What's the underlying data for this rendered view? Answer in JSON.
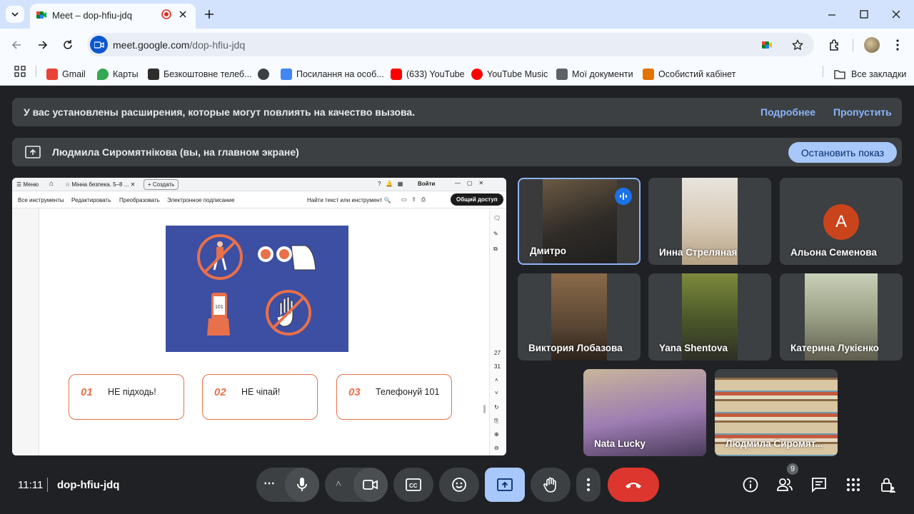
{
  "browser": {
    "tab_title": "Meet – dop-hfiu-jdq",
    "url_host": "meet.google.com",
    "url_path": "/dop-hfiu-jdq",
    "bookmarks": [
      {
        "label": "Gmail",
        "color": "#ea4335"
      },
      {
        "label": "Карты",
        "color": "#34a853"
      },
      {
        "label": "Безкоштовне телеб...",
        "color": "#2d2d2d"
      },
      {
        "label": "",
        "color": "#3c4043"
      },
      {
        "label": "Посилання на особ...",
        "color": "#4285f4"
      },
      {
        "label": "(633) YouTube",
        "color": "#ff0000"
      },
      {
        "label": "YouTube Music",
        "color": "#ff0000"
      },
      {
        "label": "Мої документи",
        "color": "#5f6368"
      },
      {
        "label": "Особистий кабінет",
        "color": "#e37400"
      }
    ],
    "all_bookmarks": "Все закладки"
  },
  "meet": {
    "extension_banner": {
      "text": "У вас установлены расширения, которые могут повлиять на качество вызова.",
      "more": "Подробнее",
      "skip": "Пропустить"
    },
    "presenting_banner": {
      "text": "Людмила Сиромятнікова (вы, на главном экране)",
      "stop": "Остановить показ"
    },
    "presentation": {
      "menu": "Меню",
      "tab": "Мінна безпека. 5–8 ...",
      "create": "Создать",
      "login": "Войти",
      "tools": [
        "Все инструменты",
        "Редактировать",
        "Преобразовать",
        "Электронное подписание"
      ],
      "search": "Найти текст или инструмент",
      "share": "Общий доступ",
      "page_numbers": [
        "27",
        "31"
      ],
      "cards": [
        {
          "num": "01",
          "text": "НЕ підходь!"
        },
        {
          "num": "02",
          "text": "НЕ чіпай!"
        },
        {
          "num": "03",
          "text": "Телефонуй 101"
        }
      ]
    },
    "participants": [
      {
        "name": "Дмитро",
        "speaking": true
      },
      {
        "name": "Инна Стреляная"
      },
      {
        "name": "Альона Семенова",
        "initial": "А",
        "avatar_color": "#c9431b"
      },
      {
        "name": "Виктория Лобазова"
      },
      {
        "name": "Yana Shentova"
      },
      {
        "name": "Катерина Лукієнко"
      },
      {
        "name": "Nata Lucky"
      },
      {
        "name": "Людмила Сиромят..."
      }
    ],
    "time": "11:11",
    "meeting_code": "dop-hfiu-jdq",
    "people_count": "9"
  }
}
